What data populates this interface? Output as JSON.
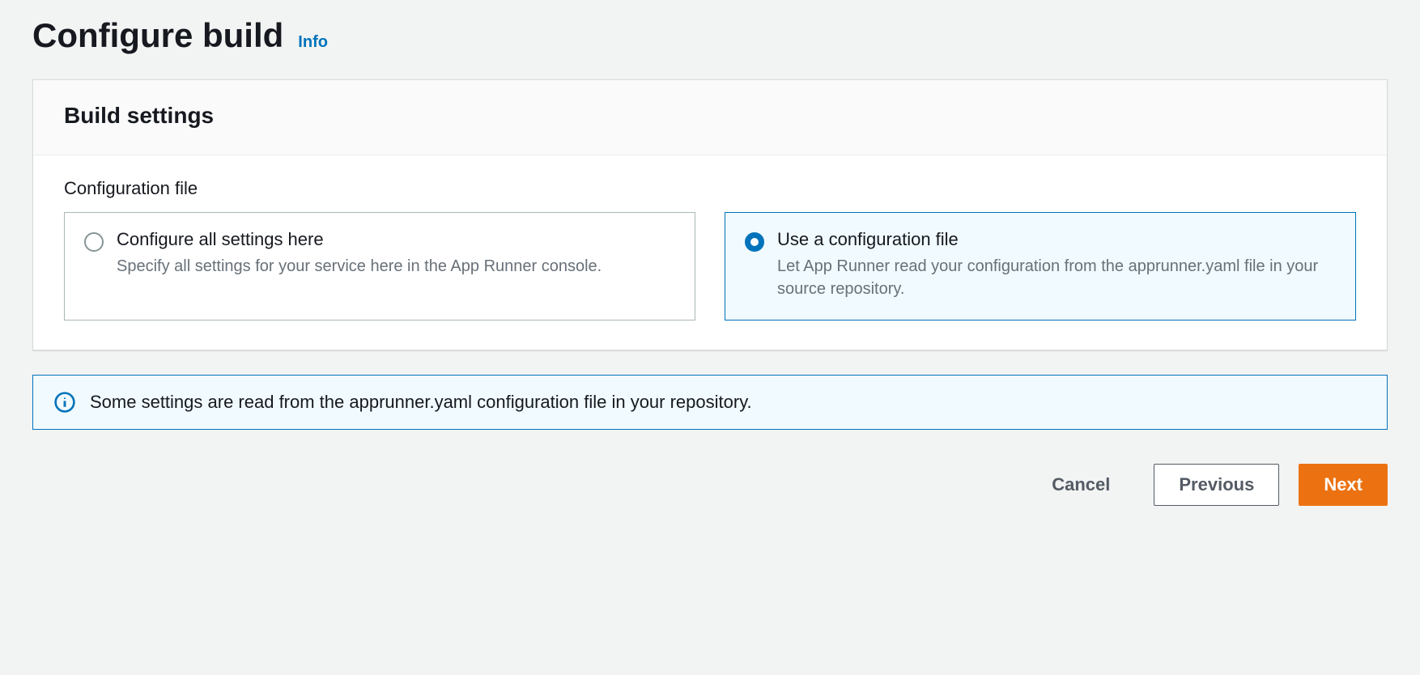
{
  "header": {
    "title": "Configure build",
    "infoLabel": "Info"
  },
  "panel": {
    "title": "Build settings",
    "fieldLabel": "Configuration file",
    "options": [
      {
        "title": "Configure all settings here",
        "desc": "Specify all settings for your service here in the App Runner console.",
        "selected": false
      },
      {
        "title": "Use a configuration file",
        "desc": "Let App Runner read your configuration from the apprunner.yaml file in your source repository.",
        "selected": true
      }
    ]
  },
  "alert": {
    "text": "Some settings are read from the apprunner.yaml configuration file in your repository."
  },
  "buttons": {
    "cancel": "Cancel",
    "previous": "Previous",
    "next": "Next"
  }
}
